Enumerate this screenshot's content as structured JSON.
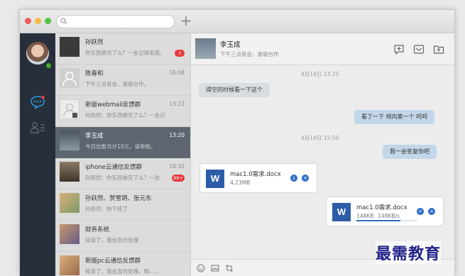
{
  "window": {
    "traffic_lights": [
      "#ec5d56",
      "#f3bc3f",
      "#54c242"
    ]
  },
  "search": {
    "placeholder": ""
  },
  "sidebar": {
    "icons": [
      "chat-bubble-icon",
      "contacts-icon"
    ],
    "accent": "#2a9bd8"
  },
  "chats": [
    {
      "name": "孙跃然",
      "snippet": "你东西做完了么？一会记得发我。",
      "time": "",
      "badge": "3",
      "avatar": "#3a3a3a"
    },
    {
      "name": "陈春和",
      "snippet": "下午三点有会，谢谢合作。",
      "time": "16:08",
      "badge": "",
      "avatar": "#cfcfcf"
    },
    {
      "name": "新版webmail反馈群",
      "snippet": "孙跃然：你东西做完了么？一会记",
      "time": "13:22",
      "badge": "",
      "avatar": "#e4e4e4"
    },
    {
      "name": "李玉成",
      "snippet": "今日出账共计10元，请审批。",
      "time": "13:20",
      "badge": "",
      "avatar": "#6e7b86"
    },
    {
      "name": "iphone云通信反馈群",
      "snippet": "孙跃然：你东西做完了么？一会",
      "time": "16:32",
      "badge": "99+",
      "avatar": "#5b5040"
    },
    {
      "name": "孙跃然、贺雪玥、张元东",
      "snippet": "孙跃然：快下班了",
      "time": "",
      "badge": "",
      "avatar": "#c99a5e"
    },
    {
      "name": "财务系统",
      "snippet": "知道了，我会及时处理",
      "time": "",
      "badge": "",
      "avatar": "#8a6a9a"
    },
    {
      "name": "新版pc云通信反馈群",
      "snippet": "知道了，我会及时处理。明......",
      "time": "",
      "badge": "",
      "avatar": "#b88a6a"
    }
  ],
  "header": {
    "name": "李玉成",
    "subtitle": "下午三点有会，谢谢合作"
  },
  "messages": {
    "ts1": "4月14日  13:25",
    "in1": "得空的时候看一下这个",
    "out1": "看了一下 倾向第一个 呵呵",
    "ts2": "4月14日  15:50",
    "out2": "我一会答复你吧",
    "file_in": {
      "name": "mac1.0需求.docx",
      "size": "4.23MB",
      "icon_letter": "W"
    },
    "file_out": {
      "name": "mac1.0需求.docx",
      "size": "148KB",
      "speed": "148KB/s",
      "icon_letter": "W",
      "progress": 0.72
    }
  },
  "input_icons": [
    "emoji-icon",
    "image-icon",
    "crop-icon"
  ],
  "watermark": "最需教育"
}
